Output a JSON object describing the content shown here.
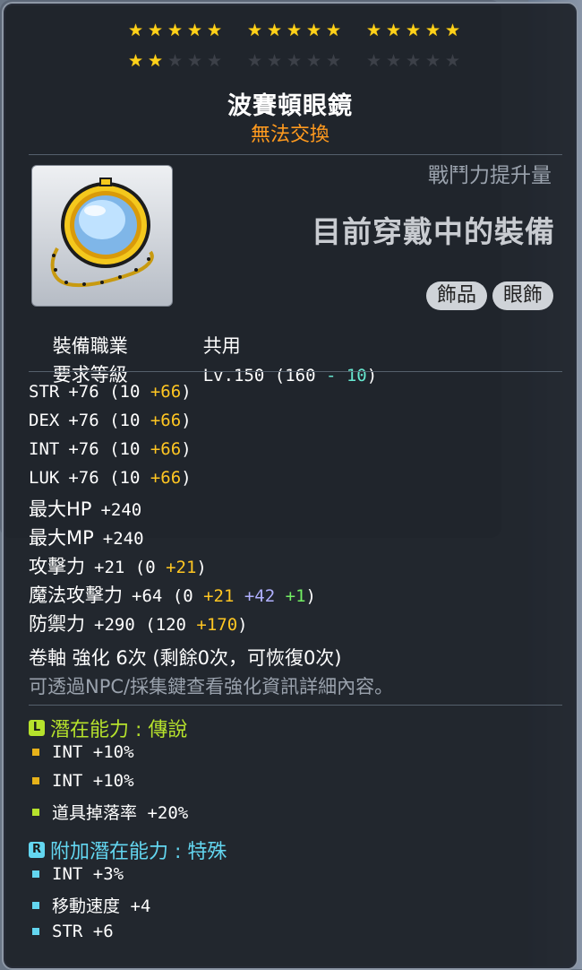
{
  "stars": {
    "row1": [
      [
        1,
        1,
        1,
        1,
        1
      ],
      [
        1,
        1,
        1,
        1,
        1
      ],
      [
        1,
        1,
        1,
        1,
        1
      ]
    ],
    "row2": [
      [
        1,
        1,
        0,
        0,
        0
      ],
      [
        0,
        0,
        0,
        0,
        0
      ],
      [
        0,
        0,
        0,
        0,
        0
      ]
    ]
  },
  "item": {
    "name": "波賽頓眼鏡",
    "trade_status": "無法交換",
    "power_label": "戰鬥力提升量",
    "equipped_label": "目前穿戴中的裝備",
    "icon": "monocle-icon",
    "tags": [
      "飾品",
      "眼飾"
    ]
  },
  "requirements": {
    "job_label": "裝備職業",
    "job_value": "共用",
    "level_label": "要求等級",
    "level_prefix": "Lv.150 (160 ",
    "level_minus": "- 10",
    "level_suffix": ")"
  },
  "stats": [
    {
      "label": "STR",
      "value": "+76",
      "open": " (10 ",
      "bonus": "+66",
      "close": ")"
    },
    {
      "label": "DEX",
      "value": "+76",
      "open": " (10 ",
      "bonus": "+66",
      "close": ")"
    },
    {
      "label": "INT",
      "value": "+76",
      "open": " (10 ",
      "bonus": "+66",
      "close": ")"
    },
    {
      "label": "LUK",
      "value": "+76",
      "open": " (10 ",
      "bonus": "+66",
      "close": ")"
    },
    {
      "label": "最大HP",
      "value": "+240"
    },
    {
      "label": "最大MP",
      "value": "+240"
    },
    {
      "label": "攻擊力",
      "value": "+21",
      "open": " (0 ",
      "bonus": "+21",
      "close": ")"
    },
    {
      "label": "魔法攻擊力",
      "value": "+64",
      "open": " (0 ",
      "bonus": "+21",
      "bonus2": " +42",
      "bonus3": " +1",
      "close": ")"
    },
    {
      "label": "防禦力",
      "value": "+290",
      "open": " (120 ",
      "bonus": "+170",
      "close": ")"
    }
  ],
  "scroll": {
    "line": "卷軸 強化 6次 (剩餘0次，可恢復0次)",
    "hint": "可透過NPC/採集鍵查看強化資訊詳細內容。"
  },
  "potential": {
    "badge": "L",
    "title": "潛在能力 : 傳說",
    "lines": [
      "INT +10%",
      "INT +10%",
      "道具掉落率 +20%"
    ],
    "dot_colors": [
      "#e7b21a",
      "#e7b21a",
      "#b6e22c"
    ]
  },
  "additional": {
    "badge": "R",
    "title": "附加潛在能力 : 特殊",
    "lines": [
      "INT +3%",
      "移動速度 +4",
      "STR +6"
    ],
    "dot_color": "#63d6f0"
  },
  "colors": {
    "name_color": "#ffffff",
    "trade_color": "#ff9a1e",
    "bonus_gold": "#ffc622",
    "potential_green": "#b6e22c",
    "additional_cyan": "#63d6f0"
  }
}
